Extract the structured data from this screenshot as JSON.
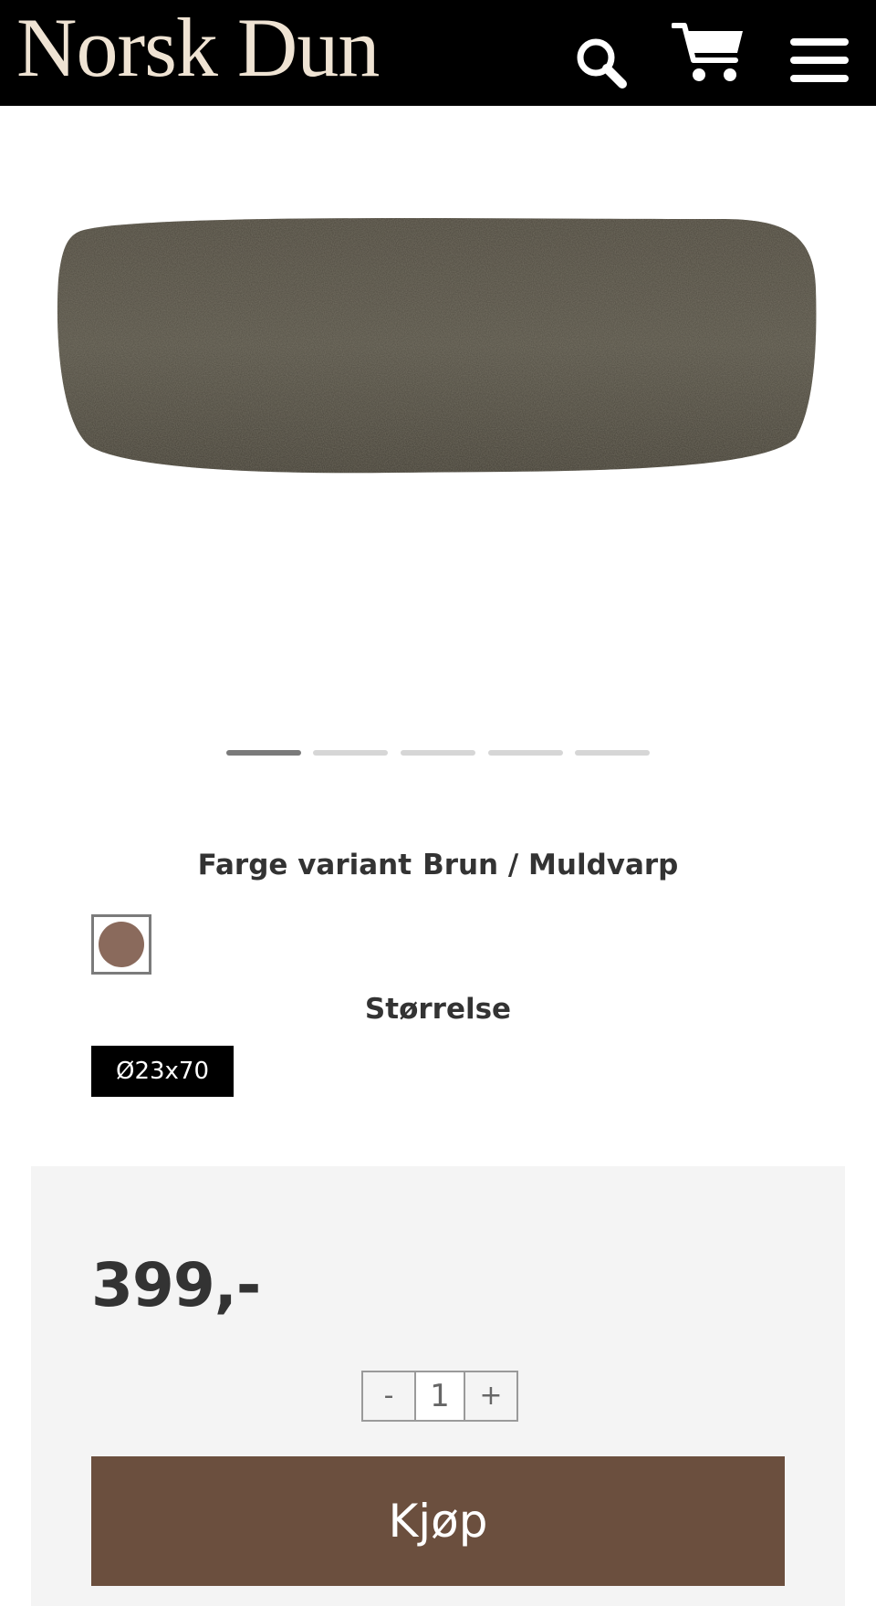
{
  "header": {
    "logo": "Norsk Dun",
    "icons": [
      "search-icon",
      "cart-icon",
      "menu-icon"
    ]
  },
  "gallery": {
    "slide_count": 5,
    "active_index": 0
  },
  "variant": {
    "label": "Farge variant",
    "value": "Brun / Muldvarp",
    "swatch_color": "#8a6a5c"
  },
  "size": {
    "label": "Størrelse",
    "options": [
      "Ø23x70"
    ],
    "selected": "Ø23x70"
  },
  "purchase": {
    "price": "399,-",
    "quantity": "1",
    "decrement": "-",
    "increment": "+",
    "buy_label": "Kjøp"
  },
  "colors": {
    "header_bg": "#000000",
    "logo": "#efe3d3",
    "buy_button": "#6b4f3e",
    "panel_bg": "#f4f4f4"
  }
}
